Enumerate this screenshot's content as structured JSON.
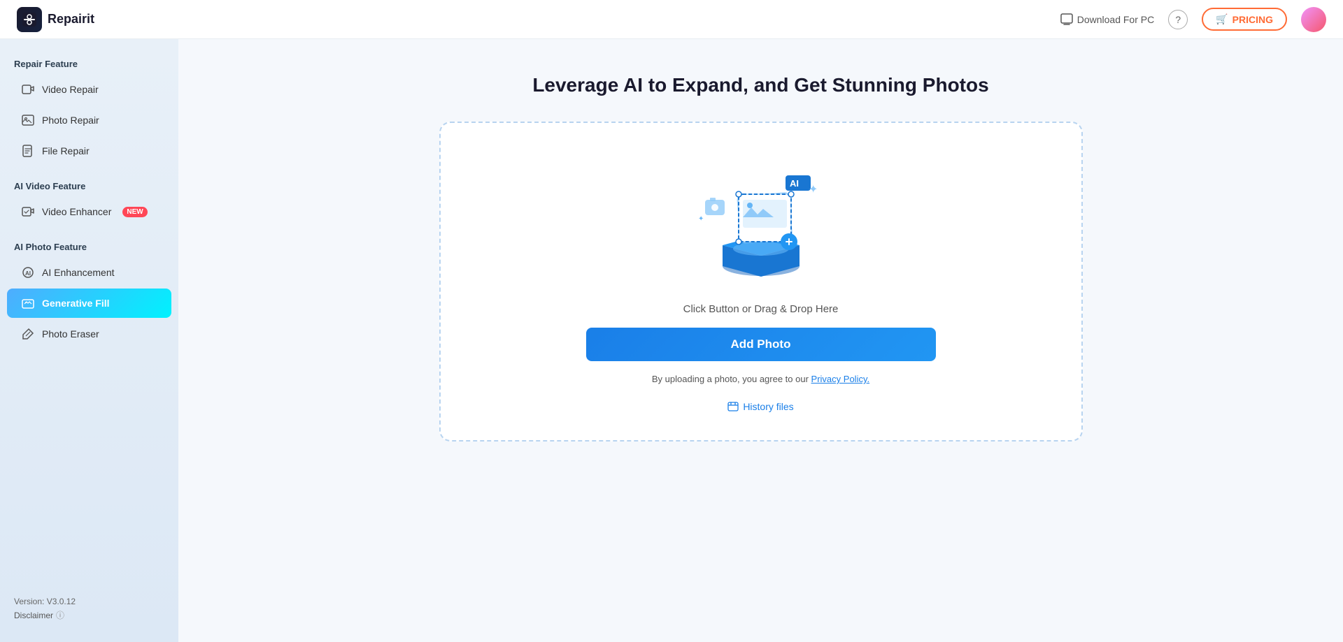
{
  "header": {
    "logo_icon": "🔧",
    "logo_text": "Repairit",
    "download_label": "Download For PC",
    "pricing_label": "PRICING",
    "pricing_icon": "🛒"
  },
  "sidebar": {
    "section1_label": "Repair Feature",
    "items_repair": [
      {
        "id": "video-repair",
        "label": "Video Repair",
        "icon": "▶",
        "active": false
      },
      {
        "id": "photo-repair",
        "label": "Photo Repair",
        "icon": "🖼",
        "active": false
      },
      {
        "id": "file-repair",
        "label": "File Repair",
        "icon": "📄",
        "active": false
      }
    ],
    "section2_label": "AI Video Feature",
    "items_ai_video": [
      {
        "id": "video-enhancer",
        "label": "Video Enhancer",
        "icon": "✨",
        "badge": "NEW",
        "active": false
      }
    ],
    "section3_label": "AI Photo Feature",
    "items_ai_photo": [
      {
        "id": "ai-enhancement",
        "label": "AI Enhancement",
        "icon": "🤖",
        "active": false
      },
      {
        "id": "generative-fill",
        "label": "Generative Fill",
        "icon": "◇",
        "active": true
      },
      {
        "id": "photo-eraser",
        "label": "Photo Eraser",
        "icon": "◇",
        "active": false
      }
    ],
    "footer": {
      "version": "Version: V3.0.12",
      "disclaimer": "Disclaimer"
    }
  },
  "main": {
    "title": "Leverage AI to Expand, and Get Stunning Photos",
    "drop_hint": "Click Button or Drag & Drop Here",
    "add_photo_label": "Add Photo",
    "privacy_text": "By uploading a photo, you agree to our ",
    "privacy_link": "Privacy Policy.",
    "history_label": "History files"
  }
}
